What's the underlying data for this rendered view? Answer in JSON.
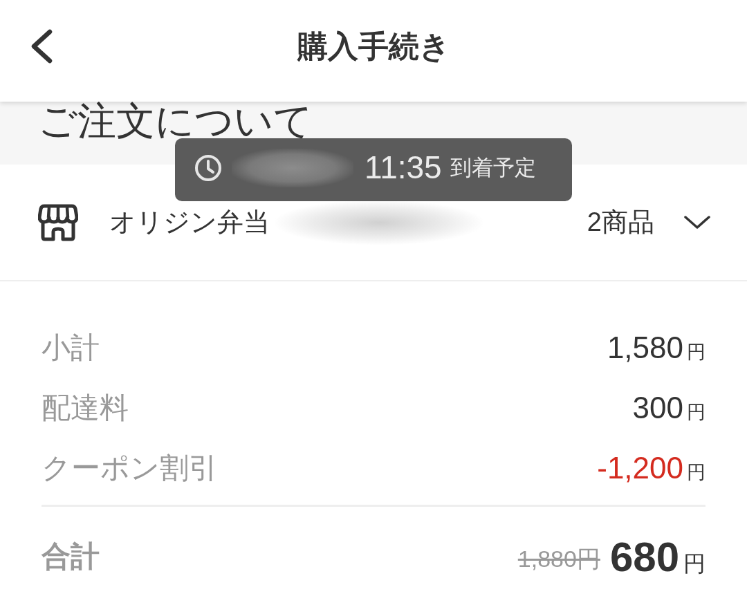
{
  "header": {
    "title": "購入手続き"
  },
  "section": {
    "title": "ご注文について"
  },
  "arrival_tooltip": {
    "time": "11:35",
    "label": "到着予定"
  },
  "store": {
    "name": "オリジン弁当",
    "item_count": "2商品",
    "expanded": false
  },
  "summary": {
    "rows": [
      {
        "label": "小計",
        "amount": "1,580",
        "unit": "円",
        "kind": "normal"
      },
      {
        "label": "配達料",
        "amount": "300",
        "unit": "円",
        "kind": "normal"
      },
      {
        "label": "クーポン割引",
        "amount": "-1,200",
        "unit": "円",
        "kind": "discount"
      }
    ],
    "total": {
      "label": "合計",
      "original_price": "1,880円",
      "amount": "680",
      "unit": "円"
    }
  }
}
